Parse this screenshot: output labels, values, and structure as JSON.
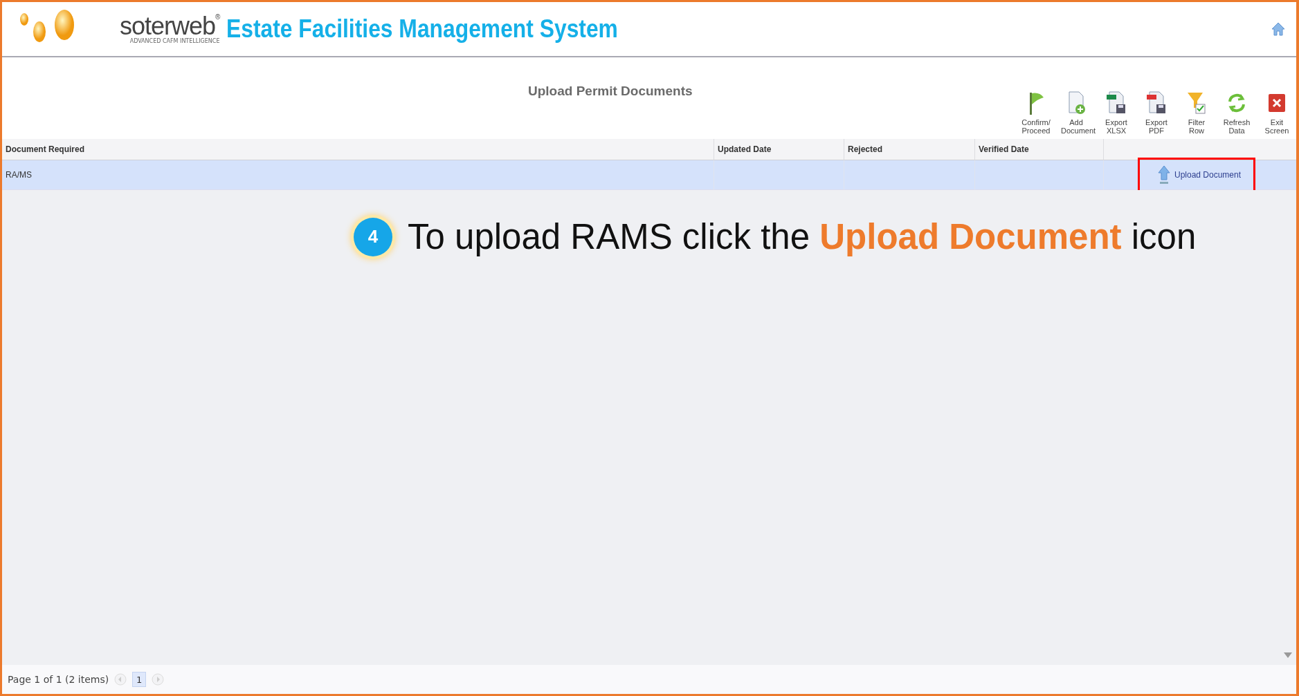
{
  "header": {
    "logo_word": "soterweb$^{®}$",
    "logo_tagline": "ADVANCED CAFM INTELLIGENCE",
    "title": "Estate Facilities Management System"
  },
  "page_title": "Upload Permit Documents",
  "toolbar": [
    {
      "kind": "flag",
      "label": "Confirm/ Proceed"
    },
    {
      "kind": "add",
      "label": "Add Document"
    },
    {
      "kind": "xlsx",
      "label": "Export XLSX"
    },
    {
      "kind": "pdf",
      "label": "Export PDF"
    },
    {
      "kind": "filter",
      "label": "Filter Row"
    },
    {
      "kind": "refresh",
      "label": "Refresh Data"
    },
    {
      "kind": "exit",
      "label": "Exit Screen"
    }
  ],
  "table": {
    "columns": [
      "Document Required",
      "Updated Date",
      "Rejected",
      "Verified Date"
    ],
    "rows": [
      {
        "document": "RA/MS",
        "selected": true,
        "action": "Upload Document",
        "highlighted": true
      }
    ]
  },
  "callout": {
    "step": "4",
    "text": "To upload RAMS click the **Upload Document** icon"
  },
  "pager": {
    "summary": "Page 1 of 1 (2 items)",
    "pages": [
      {
        "label": "1",
        "selected": true
      }
    ]
  }
}
